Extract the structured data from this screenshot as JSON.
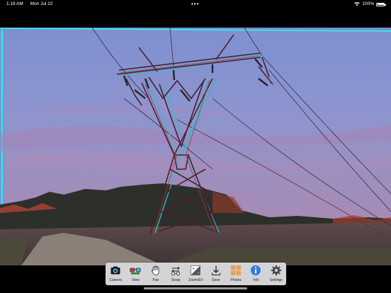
{
  "status_bar": {
    "time": "1:18 AM",
    "date": "Mon Jul 22",
    "dots": "•••",
    "battery_percent": "100%",
    "battery_level": 1.0
  },
  "image": {
    "description_icon": "power-pylon-anaglyph-photo"
  },
  "toolbar": {
    "items": [
      {
        "label": "Camera",
        "icon": "camera-icon"
      },
      {
        "label": "View",
        "icon": "glasses-icon"
      },
      {
        "label": "Pan",
        "icon": "hand-icon"
      },
      {
        "label": "Swap",
        "icon": "swap-icon"
      },
      {
        "label": "Zoom/EV",
        "icon": "exposure-icon"
      },
      {
        "label": "Save",
        "icon": "download-icon"
      },
      {
        "label": "Photos",
        "icon": "photos-grid-icon"
      },
      {
        "label": "Info",
        "icon": "info-icon"
      },
      {
        "label": "Settings",
        "icon": "gear-icon"
      }
    ]
  },
  "colors": {
    "toolbar_bg": "#d4d4d6",
    "frame_accent": "#36e1e6",
    "info_blue": "#2f7de0",
    "photos_orange": "#e6a25a"
  }
}
